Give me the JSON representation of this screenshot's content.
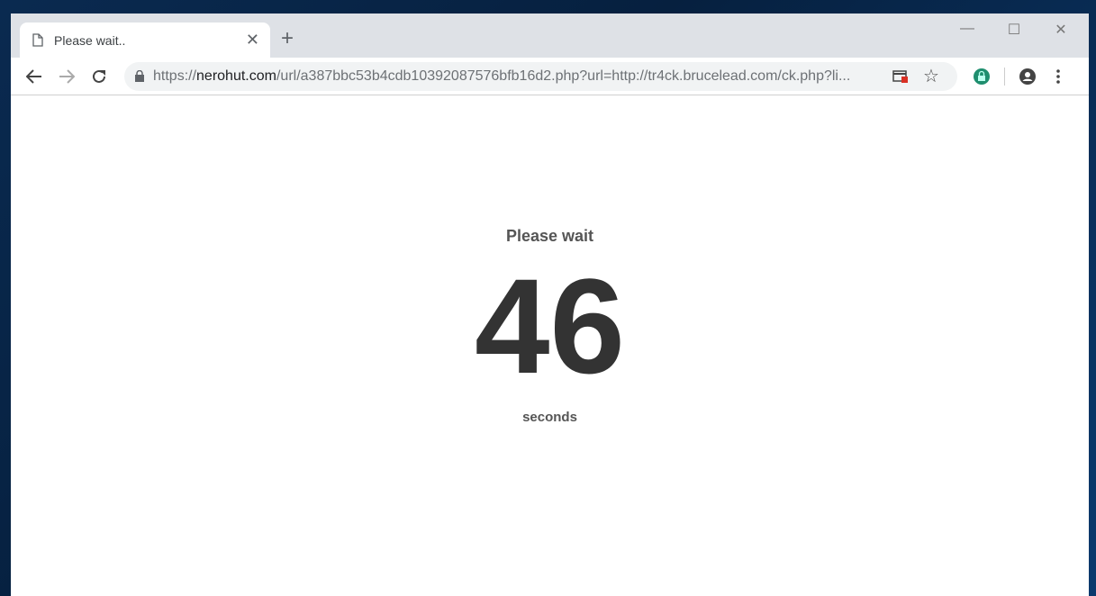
{
  "tab": {
    "title": "Please wait.."
  },
  "address": {
    "scheme": "https://",
    "domain": "nerohut.com",
    "path": "/url/a387bbc53b4cdb10392087576bfb16d2.php?url=http://tr4ck.brucelead.com/ck.php?li..."
  },
  "page": {
    "heading": "Please wait",
    "countdown": "46",
    "unit": "seconds"
  },
  "colors": {
    "extension": "#1e8e6e",
    "blocked": "#d93025"
  }
}
